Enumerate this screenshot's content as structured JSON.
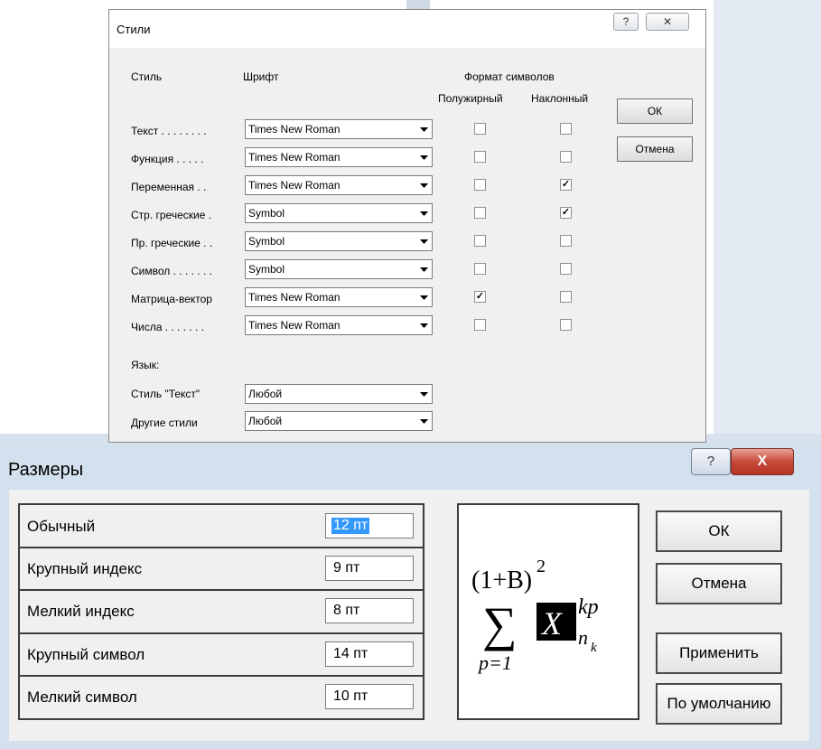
{
  "styles_dialog": {
    "title": "Стили",
    "help_glyph": "?",
    "close_glyph": "✕",
    "headers": {
      "style": "Стиль",
      "font": "Шрифт",
      "char_format": "Формат символов",
      "bold": "Полужирный",
      "italic": "Наклонный"
    },
    "rows": [
      {
        "label": "Текст . . . . . . . .",
        "font": "Times New Roman",
        "bold": false,
        "italic": false
      },
      {
        "label": "Функция . . . . .",
        "font": "Times New Roman",
        "bold": false,
        "italic": false
      },
      {
        "label": "Переменная . .",
        "font": "Times New Roman",
        "bold": false,
        "italic": true
      },
      {
        "label": "Стр. греческие .",
        "font": "Symbol",
        "bold": false,
        "italic": true
      },
      {
        "label": "Пр. греческие . .",
        "font": "Symbol",
        "bold": false,
        "italic": false
      },
      {
        "label": "Символ . . . . . . .",
        "font": "Symbol",
        "bold": false,
        "italic": false
      },
      {
        "label": "Матрица-вектор",
        "font": "Times New Roman",
        "bold": true,
        "italic": false
      },
      {
        "label": "Числа . . . . . . .",
        "font": "Times New Roman",
        "bold": false,
        "italic": false
      }
    ],
    "language_label": "Язык:",
    "lang_rows": [
      {
        "label": "Стиль \"Текст\"",
        "value": "Любой"
      },
      {
        "label": "Другие стили",
        "value": "Любой"
      }
    ],
    "ok_label": "ОК",
    "cancel_label": "Отмена",
    "check_glyph": "✓"
  },
  "sizes_dialog": {
    "title": "Размеры",
    "help_glyph": "?",
    "close_glyph": "X",
    "rows": [
      {
        "label": "Обычный",
        "value": "12 пт",
        "selected": true
      },
      {
        "label": "Крупный индекс",
        "value": "9 пт",
        "selected": false
      },
      {
        "label": "Мелкий индекс",
        "value": "8 пт",
        "selected": false
      },
      {
        "label": "Крупный символ",
        "value": "14 пт",
        "selected": false
      },
      {
        "label": "Мелкий символ",
        "value": "10 пт",
        "selected": false
      }
    ],
    "preview": {
      "numerator": "(1+B)",
      "power": "2",
      "sum_symbol": "∑",
      "lower_limit": "p=1",
      "matrix": "X",
      "superscript": "kp",
      "subscript": "n",
      "subsub": "k"
    },
    "buttons": {
      "ok": "ОК",
      "cancel": "Отмена",
      "apply": "Применить",
      "default": "По умолчанию"
    }
  },
  "colors": {
    "selection": "#3399ff",
    "close_red": "#c7493a",
    "frame": "#d3e0ee"
  }
}
